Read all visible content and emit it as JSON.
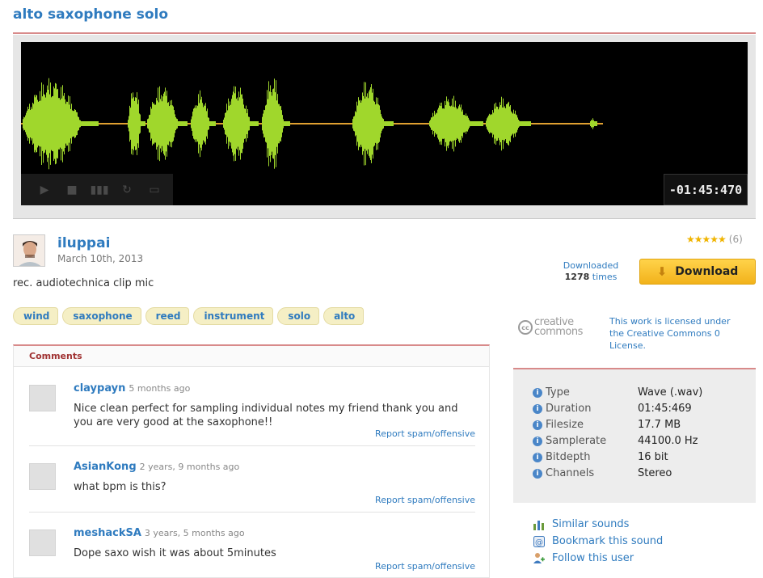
{
  "page": {
    "title": "alto saxophone solo"
  },
  "player": {
    "timer": "-01:45:470",
    "controls": {
      "play": "▶",
      "stop": "■",
      "spectrogram": "▮▮▮",
      "loop": "↻",
      "zoom": "▭"
    }
  },
  "user": {
    "name": "iluppai",
    "date": "March 10th, 2013"
  },
  "description": "rec. audiotechnica clip mic",
  "tags": [
    "wind",
    "saxophone",
    "reed",
    "instrument",
    "solo",
    "alto"
  ],
  "comments": {
    "header": "Comments",
    "report_label": "Report spam/offensive",
    "items": [
      {
        "user": "claypayn",
        "time": "5 months ago",
        "text": "Nice clean perfect for sampling individual notes my friend thank you and you are very good at the saxophone!!"
      },
      {
        "user": "AsianKong",
        "time": "2 years, 9 months ago",
        "text": "what bpm is this?"
      },
      {
        "user": "meshackSA",
        "time": "3 years, 5 months ago",
        "text": "Dope saxo wish it was about 5minutes"
      }
    ]
  },
  "rating": {
    "stars": "★★★★★",
    "count": "(6)",
    "value": 5
  },
  "downloads": {
    "label": "Downloaded",
    "count": "1278",
    "suffix": "times"
  },
  "download_button": {
    "label": "Download",
    "icon": "down-arrow-icon"
  },
  "license": {
    "logo_cc": "cc",
    "logo_text_1": "creative",
    "logo_text_2": "commons",
    "text": "This work is licensed under the Creative Commons 0 License."
  },
  "meta": [
    {
      "label": "Type",
      "value": "Wave (.wav)"
    },
    {
      "label": "Duration",
      "value": "01:45:469"
    },
    {
      "label": "Filesize",
      "value": "17.7 MB"
    },
    {
      "label": "Samplerate",
      "value": "44100.0 Hz"
    },
    {
      "label": "Bitdepth",
      "value": "16 bit"
    },
    {
      "label": "Channels",
      "value": "Stereo"
    }
  ],
  "links": [
    {
      "label": "Similar sounds",
      "icon": "similar-sounds-icon"
    },
    {
      "label": "Bookmark this sound",
      "icon": "bookmark-icon"
    },
    {
      "label": "Follow this user",
      "icon": "follow-user-icon"
    }
  ],
  "colors": {
    "link": "#2f7bbf",
    "accent_rule": "#d88a8a",
    "download": "#f2b21b",
    "wave_green": "#7fd12a",
    "wave_yellow": "#d8e02a",
    "wave_line": "#e0a030"
  }
}
